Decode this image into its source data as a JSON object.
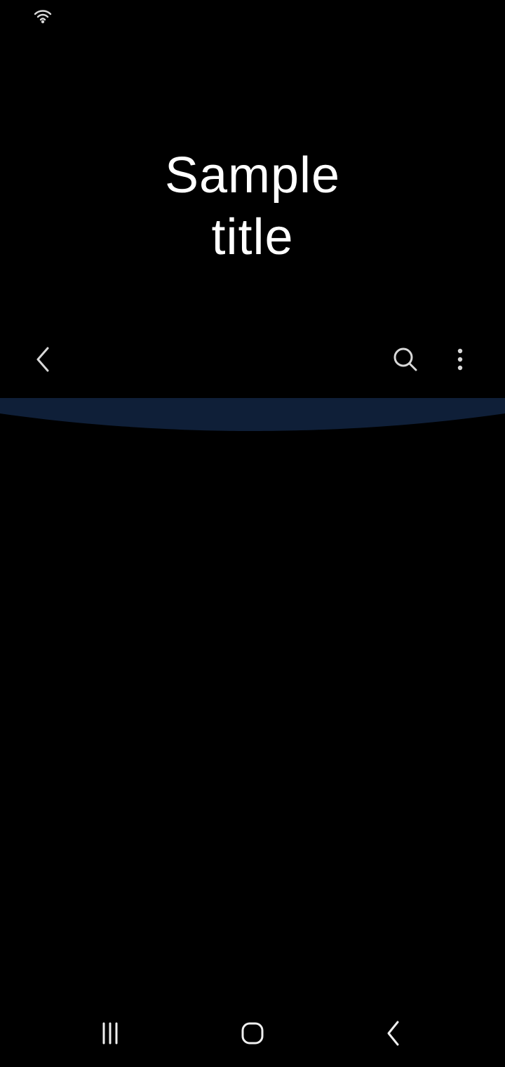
{
  "status_bar": {
    "wifi_icon": "wifi-icon"
  },
  "header": {
    "title_line_1": "Sample",
    "title_line_2": "title"
  },
  "toolbar": {
    "back_icon": "chevron-left-icon",
    "search_icon": "search-icon",
    "more_icon": "more-vertical-icon"
  },
  "content": {
    "accent_color": "#0f1f38"
  },
  "navigation": {
    "recents_icon": "recents-icon",
    "home_icon": "home-icon",
    "back_icon": "back-icon"
  }
}
